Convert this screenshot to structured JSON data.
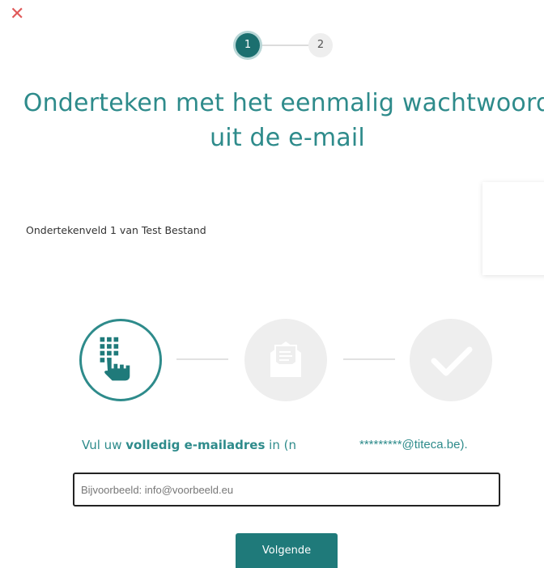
{
  "close": {
    "icon": "close-icon",
    "glyph": "✕",
    "color": "#e05a5a"
  },
  "stepper": {
    "steps": [
      "1",
      "2"
    ],
    "active": 1
  },
  "title": {
    "line1": "Onderteken met het eenmalig wachtwoord",
    "line2": "uit de e-mail"
  },
  "field_label": "Ondertekenveld 1 van Test Bestand",
  "process": {
    "steps": [
      {
        "icon": "keypad-hand-icon",
        "state": "active"
      },
      {
        "icon": "open-envelope-icon",
        "state": "inactive"
      },
      {
        "icon": "checkmark-icon",
        "state": "inactive"
      }
    ]
  },
  "instruction": {
    "prefix": "Vul uw ",
    "bold": "volledig e-mailadres",
    "suffix": " in (n",
    "masked_email": "*********@titeca.be)."
  },
  "email_input": {
    "value": "",
    "placeholder": "Bijvoorbeeld: info@voorbeeld.eu"
  },
  "next_button": {
    "label": "Volgende"
  },
  "colors": {
    "accent": "#2e8b8b",
    "accent_dark": "#1b6f6f",
    "inactive": "#eeeeee"
  }
}
